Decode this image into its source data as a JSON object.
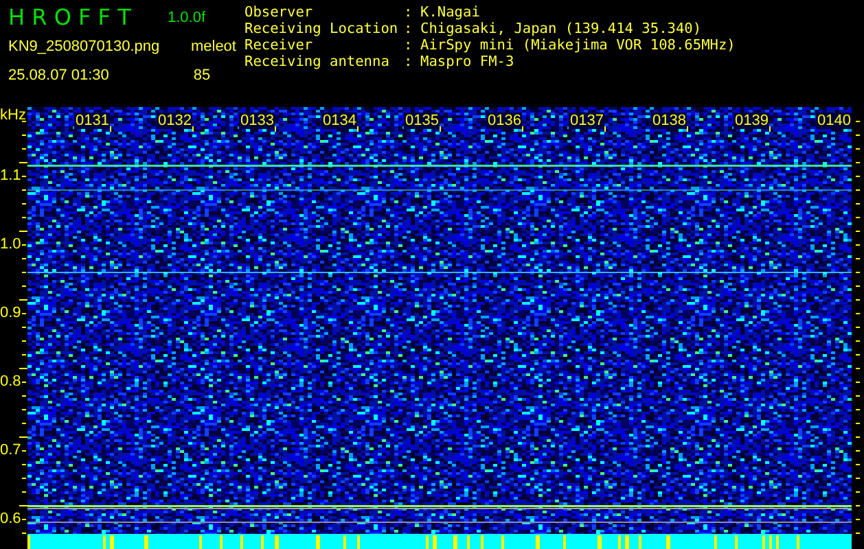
{
  "header": {
    "app_name": "H R O F F T",
    "version": "1.0.0f",
    "file_name": "KN9_2508070130.png",
    "timestamp": "25.08.07 01:30",
    "mode": "meleot",
    "count": "85"
  },
  "info": [
    {
      "label": "Observer",
      "separator": ":",
      "value": "K.Nagai"
    },
    {
      "label": "Receiving Location",
      "separator": ":",
      "value": "Chigasaki, Japan (139.414 35.340)"
    },
    {
      "label": "Receiver",
      "separator": ":",
      "value": "AirSpy mini (Miakejima VOR 108.65MHz)"
    },
    {
      "label": "Receiving antenna",
      "separator": ":",
      "value": "Maspro FM-3"
    }
  ],
  "y_axis": {
    "unit": "kHz",
    "ticks": [
      "1.1",
      "1.0",
      "0.9",
      "0.8",
      "0.7",
      "0.6"
    ]
  },
  "time_labels": [
    "0131",
    "0132",
    "0133",
    "0134",
    "0135",
    "0136",
    "0137",
    "0138",
    "0139",
    "0140"
  ]
}
